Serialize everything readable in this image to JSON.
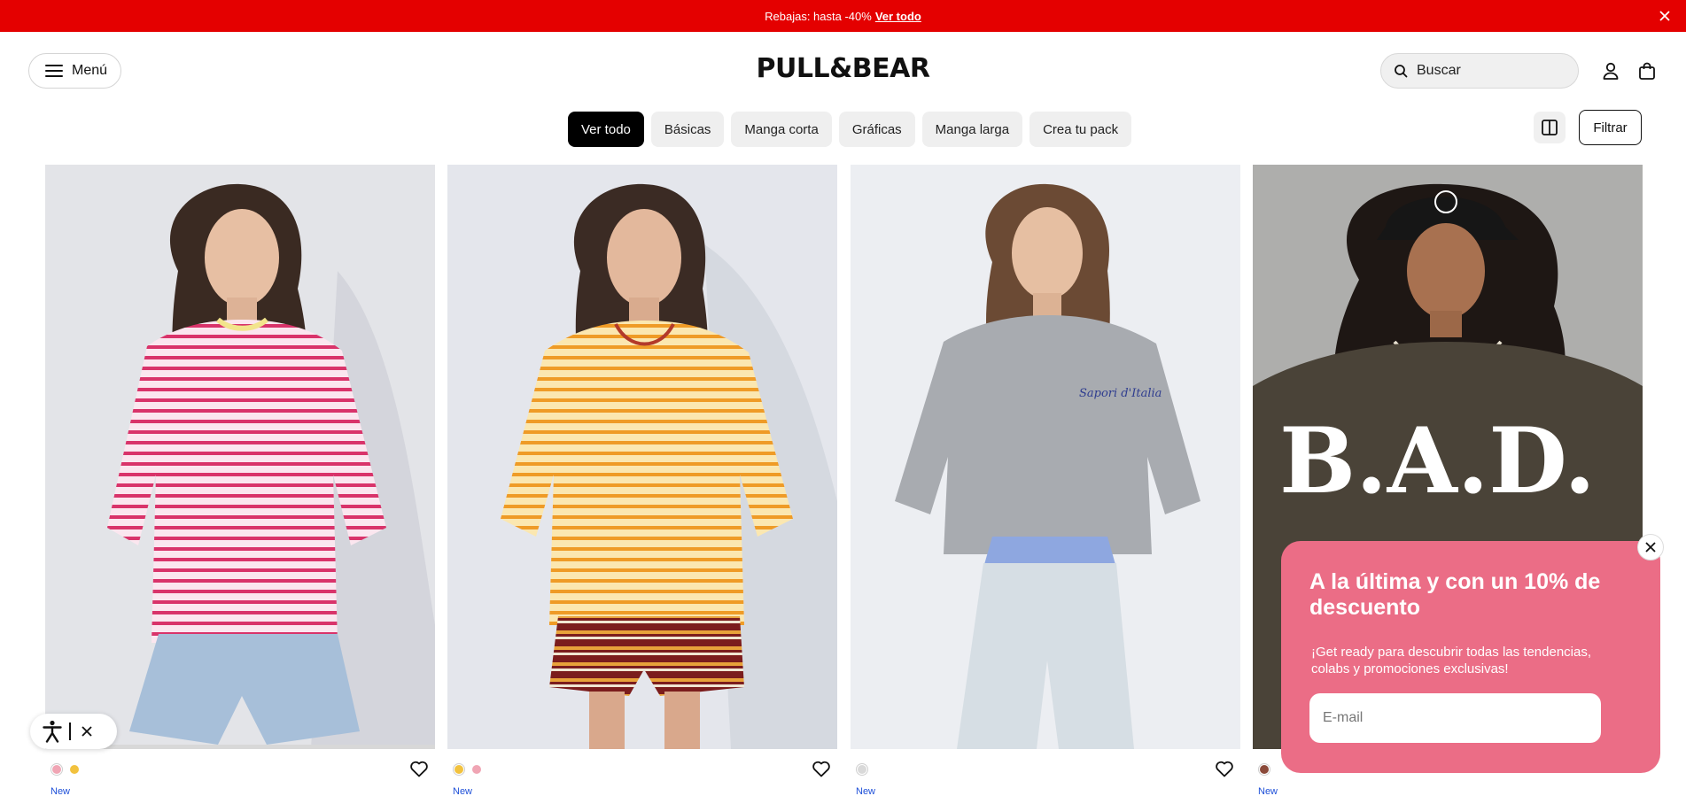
{
  "promo": {
    "text": "Rebajas: hasta -40%",
    "link": "Ver todo"
  },
  "header": {
    "menu_label": "Menú",
    "logo": "PULL&BEAR",
    "search_placeholder": "Buscar"
  },
  "categories": [
    {
      "label": "Ver todo",
      "active": true
    },
    {
      "label": "Básicas",
      "active": false
    },
    {
      "label": "Manga corta",
      "active": false
    },
    {
      "label": "Gráficas",
      "active": false
    },
    {
      "label": "Manga larga",
      "active": false
    },
    {
      "label": "Crea tu pack",
      "active": false
    }
  ],
  "filter_label": "Filtrar",
  "products": [
    {
      "badge": "New",
      "swatches": [
        "#f0a5b4",
        "#f2c23e"
      ],
      "image": "pink striped t-shirt"
    },
    {
      "badge": "New",
      "swatches": [
        "#f2c23e",
        "#f0a5b4"
      ],
      "image": "yellow striped t-shirt"
    },
    {
      "badge": "New",
      "swatches": [
        "#d9d9d9"
      ],
      "image": "grey graphic t-shirt"
    },
    {
      "badge": "New",
      "swatches": [
        "#8b4a3a"
      ],
      "image": "brown graphic t-shirt B.A.D."
    }
  ],
  "graphic_text": "B.A.D.",
  "print_text": "Sapori d'Italia",
  "newsletter": {
    "title": "A la última y con un 10% de descuento",
    "description": "¡Get ready para descubrir todas las tendencias, colabs y promociones exclusivas!",
    "email_placeholder": "E-mail"
  },
  "colors": {
    "promo_bg": "#e40000",
    "popup_bg": "#eb6d86",
    "new_badge": "#1d4fd8"
  }
}
